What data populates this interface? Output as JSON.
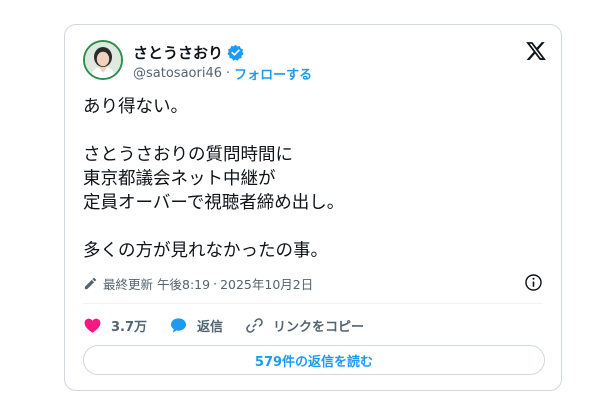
{
  "author": {
    "name": "さとうさおり",
    "handle": "@satosaori46",
    "separator": "·",
    "follow_label": "フォローする",
    "verified": true
  },
  "tweet": {
    "paragraphs": [
      [
        "あり得ない。"
      ],
      [
        "さとうさおりの質問時間に",
        "東京都議会ネット中継が",
        "定員オーバーで視聴者締め出し。"
      ],
      [
        "多くの方が見れなかったの事。"
      ]
    ]
  },
  "meta": {
    "edited_label": "最終更新",
    "time": "午後8:19",
    "separator": "·",
    "date": "2025年10月2日"
  },
  "actions": {
    "likes": "3.7万",
    "reply_label": "返信",
    "copy_link_label": "リンクをコピー"
  },
  "replies_button_label": "579件の返信を読む",
  "icons": {
    "logo": "x-logo-icon",
    "verified": "verified-badge-icon",
    "edit": "pencil-icon",
    "info": "info-icon",
    "like": "heart-icon",
    "reply": "speech-bubble-icon",
    "link": "link-icon"
  },
  "colors": {
    "accent": "#1d9bf0",
    "like": "#f91880",
    "text": "#0f1419",
    "muted": "#536471",
    "border": "#cfd9de"
  }
}
